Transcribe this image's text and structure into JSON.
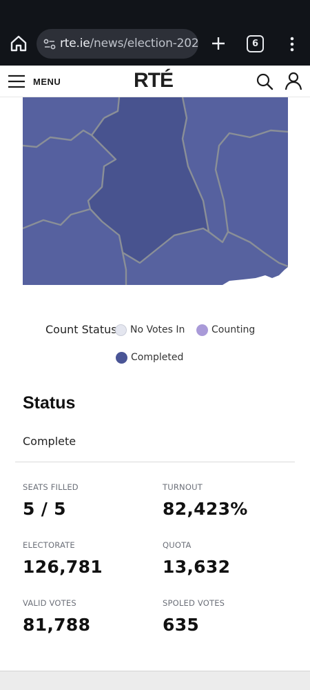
{
  "browser": {
    "url_host": "rte.ie",
    "url_path": "/news/election-202",
    "tab_count": "6"
  },
  "header": {
    "menu_label": "MENU",
    "logo_text": "RTÉ"
  },
  "colors": {
    "completed": "#4a5596",
    "counting": "#a99ad8",
    "no_votes_in": "#e4e6ef",
    "map_border": "#8a8f97"
  },
  "legend": {
    "title": "Count Status",
    "items": [
      {
        "label": "No Votes In",
        "icon": "circle-light-icon"
      },
      {
        "label": "Counting",
        "icon": "circle-lavender-icon"
      },
      {
        "label": "Completed",
        "icon": "circle-navy-icon"
      }
    ]
  },
  "status": {
    "heading": "Status",
    "value": "Complete"
  },
  "stats": [
    {
      "label": "SEATS FILLED",
      "value": "5 / 5"
    },
    {
      "label": "TURNOUT",
      "value": "82,423%"
    },
    {
      "label": "ELECTORATE",
      "value": "126,781"
    },
    {
      "label": "QUOTA",
      "value": "13,632"
    },
    {
      "label": "VALID VOTES",
      "value": "81,788"
    },
    {
      "label": "SPOLED VOTES",
      "value": "635"
    }
  ]
}
